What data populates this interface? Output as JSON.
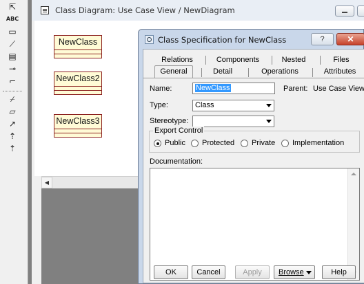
{
  "toolbox": {
    "tools": [
      {
        "name": "selection-arrow-icon",
        "glyph": "⇱"
      },
      {
        "name": "text-tool-icon",
        "glyph": "ABC"
      },
      {
        "name": "note-icon",
        "glyph": "▭"
      },
      {
        "name": "anchor-note-icon",
        "glyph": "⟋"
      },
      {
        "name": "class-icon",
        "glyph": "▤"
      },
      {
        "name": "interface-icon",
        "glyph": "⊸"
      },
      {
        "name": "association-icon",
        "glyph": "⌐"
      },
      {
        "name": "unidirectional-association-icon",
        "glyph": "⌿"
      },
      {
        "name": "package-icon",
        "glyph": "▱"
      },
      {
        "name": "dependency-icon",
        "glyph": "↗"
      },
      {
        "name": "generalization-icon",
        "glyph": "⇡"
      },
      {
        "name": "realize-icon",
        "glyph": "⇡"
      }
    ]
  },
  "diagram_window": {
    "title": "Class Diagram: Use Case View / NewDiagram",
    "scroll_left_glyph": "◀"
  },
  "classes": [
    {
      "name": "NewClass"
    },
    {
      "name": "NewClass2"
    },
    {
      "name": "NewClass3"
    }
  ],
  "dialog": {
    "title": "Class Specification for NewClass",
    "help_glyph": "?",
    "close_glyph": "✕",
    "tabs_row1": [
      "Relations",
      "Components",
      "Nested",
      "Files"
    ],
    "tabs_row2": [
      "General",
      "Detail",
      "Operations",
      "Attributes"
    ],
    "selected_tab": "General",
    "name_label": "Name:",
    "name_value": "NewClass",
    "parent_label": "Parent:",
    "parent_value": "Use Case View",
    "type_label": "Type:",
    "type_value": "Class",
    "stereotype_label": "Stereotype:",
    "stereotype_value": "",
    "export_control_label": "Export Control",
    "export_options": [
      {
        "label": "Public",
        "selected": true
      },
      {
        "label": "Protected",
        "selected": false
      },
      {
        "label": "Private",
        "selected": false
      },
      {
        "label": "Implementation",
        "selected": false
      }
    ],
    "documentation_label": "Documentation:",
    "documentation_value": "",
    "buttons": {
      "ok": "OK",
      "cancel": "Cancel",
      "apply": "Apply",
      "browse": "Browse",
      "help": "Help"
    }
  },
  "colors": {
    "class_fill": "#fffbd6",
    "class_border": "#8b1f1f",
    "name_highlight": "#3399ff"
  }
}
